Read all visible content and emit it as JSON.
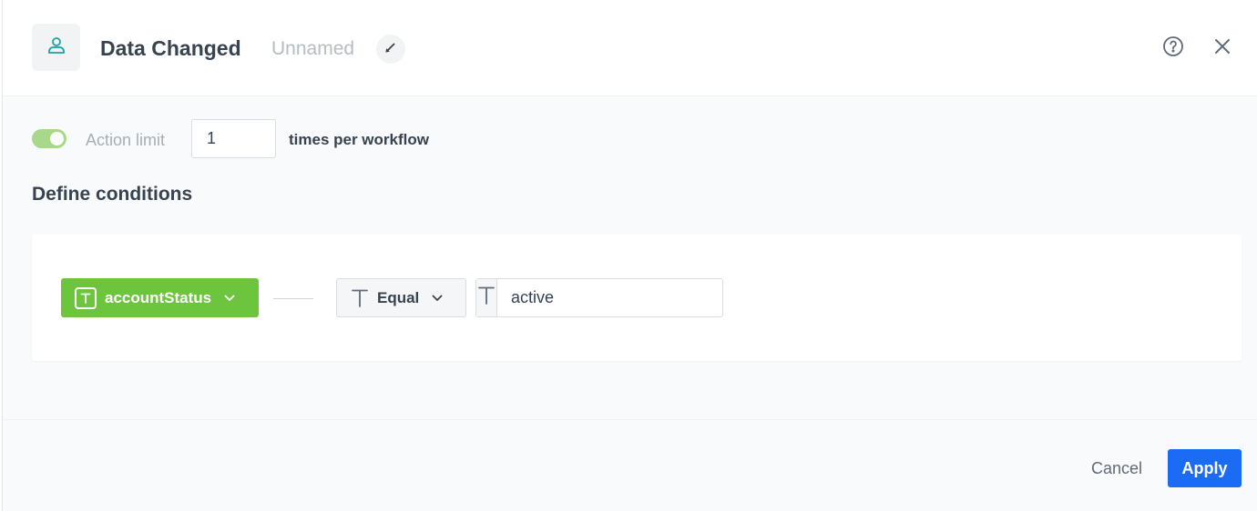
{
  "header": {
    "title": "Data Changed",
    "subtitle": "Unnamed",
    "icons": {
      "node": "user-icon",
      "edit": "pencil-icon",
      "help": "question-circle-icon",
      "close": "close-icon"
    }
  },
  "action_limit": {
    "enabled": true,
    "label": "Action limit",
    "value": "1",
    "suffix": "times per workflow"
  },
  "conditions": {
    "title": "Define conditions",
    "items": [
      {
        "parameter": "accountStatus",
        "parameter_type_icon": "text-type-icon",
        "operator": "Equal",
        "operator_type_icon": "text-type-icon",
        "value_type_icon": "text-type-icon",
        "value": "active"
      }
    ]
  },
  "footer": {
    "cancel_label": "Cancel",
    "apply_label": "Apply"
  },
  "colors": {
    "accent_green": "#6cc53d",
    "toggle_on": "#a8d98a",
    "primary_blue": "#1b6bf5",
    "icon_teal": "#1aa3a3",
    "text_dark": "#384350",
    "text_muted": "#b6bcc3"
  }
}
